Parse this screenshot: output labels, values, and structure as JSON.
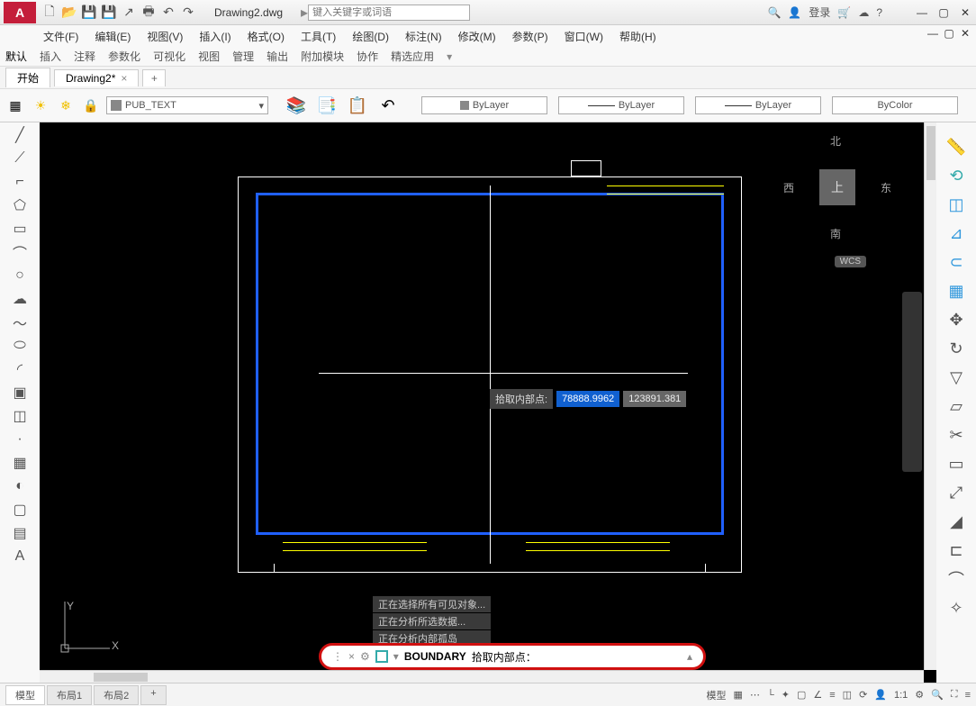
{
  "app": {
    "logo": "A",
    "title": "Drawing2.dwg"
  },
  "qat": {
    "search_placeholder": "键入关键字或词语",
    "login": "登录"
  },
  "menu": {
    "file": "文件(F)",
    "edit": "编辑(E)",
    "view": "视图(V)",
    "insert": "插入(I)",
    "format": "格式(O)",
    "tools": "工具(T)",
    "draw": "绘图(D)",
    "dimension": "标注(N)",
    "modify": "修改(M)",
    "parametric": "参数(P)",
    "window": "窗口(W)",
    "help": "帮助(H)"
  },
  "ribbon": {
    "tabs": [
      "默认",
      "插入",
      "注释",
      "参数化",
      "可视化",
      "视图",
      "管理",
      "输出",
      "附加模块",
      "协作",
      "精选应用"
    ],
    "active": "默认"
  },
  "doctabs": {
    "start": "开始",
    "current": "Drawing2*"
  },
  "layer": {
    "current": "PUB_TEXT",
    "combo1": "ByLayer",
    "combo2": "ByLayer",
    "combo3": "ByLayer",
    "combo4": "ByColor"
  },
  "viewcube": {
    "top": "上",
    "n": "北",
    "s": "南",
    "e": "东",
    "w": "西",
    "wcs": "WCS"
  },
  "coord": {
    "label": "拾取内部点:",
    "x": "78888.9962",
    "y": "123891.381"
  },
  "history": {
    "l1": "正在选择所有可见对象...",
    "l2": "正在分析所选数据...",
    "l3": "正在分析内部孤岛"
  },
  "ucs": {
    "x": "X",
    "y": "Y"
  },
  "command": {
    "name": "BOUNDARY",
    "prompt": "拾取内部点："
  },
  "status": {
    "model": "模型",
    "layout1": "布局1",
    "layout2": "布局2",
    "model2": "模型",
    "ratio": "1:1"
  }
}
